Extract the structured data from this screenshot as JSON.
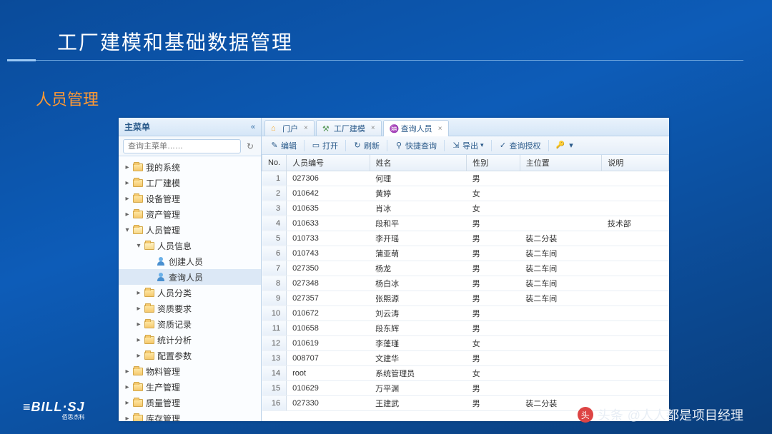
{
  "slide": {
    "title": "工厂建模和基础数据管理",
    "subtitle": "人员管理"
  },
  "sidebar": {
    "header": "主菜单",
    "search_placeholder": "查询主菜单……",
    "nodes": [
      {
        "label": "我的系统",
        "depth": 0,
        "expand": "▸",
        "icon": "folder"
      },
      {
        "label": "工厂建模",
        "depth": 0,
        "expand": "▸",
        "icon": "folder"
      },
      {
        "label": "设备管理",
        "depth": 0,
        "expand": "▸",
        "icon": "folder"
      },
      {
        "label": "资产管理",
        "depth": 0,
        "expand": "▸",
        "icon": "folder"
      },
      {
        "label": "人员管理",
        "depth": 0,
        "expand": "▾",
        "icon": "folder-open"
      },
      {
        "label": "人员信息",
        "depth": 1,
        "expand": "▾",
        "icon": "folder-open"
      },
      {
        "label": "创建人员",
        "depth": 2,
        "expand": "",
        "icon": "person"
      },
      {
        "label": "查询人员",
        "depth": 2,
        "expand": "",
        "icon": "person",
        "selected": true
      },
      {
        "label": "人员分类",
        "depth": 1,
        "expand": "▸",
        "icon": "folder"
      },
      {
        "label": "资质要求",
        "depth": 1,
        "expand": "▸",
        "icon": "folder"
      },
      {
        "label": "资质记录",
        "depth": 1,
        "expand": "▸",
        "icon": "folder"
      },
      {
        "label": "统计分析",
        "depth": 1,
        "expand": "▸",
        "icon": "folder"
      },
      {
        "label": "配置参数",
        "depth": 1,
        "expand": "▸",
        "icon": "folder"
      },
      {
        "label": "物料管理",
        "depth": 0,
        "expand": "▸",
        "icon": "folder"
      },
      {
        "label": "生产管理",
        "depth": 0,
        "expand": "▸",
        "icon": "folder"
      },
      {
        "label": "质量管理",
        "depth": 0,
        "expand": "▸",
        "icon": "folder"
      },
      {
        "label": "库存管理",
        "depth": 0,
        "expand": "▸",
        "icon": "folder"
      }
    ]
  },
  "tabs": [
    {
      "label": "门户",
      "icon": "home"
    },
    {
      "label": "工厂建模",
      "icon": "factory"
    },
    {
      "label": "查询人员",
      "icon": "chat",
      "active": true
    }
  ],
  "toolbar": [
    {
      "label": "编辑",
      "icon": "✎"
    },
    {
      "label": "打开",
      "icon": "▭"
    },
    {
      "label": "刷新",
      "icon": "↻"
    },
    {
      "label": "快捷查询",
      "icon": "⚲"
    },
    {
      "label": "导出",
      "icon": "⇲",
      "dropdown": true
    },
    {
      "label": "查询授权",
      "icon": "✓"
    },
    {
      "label": "",
      "icon": "▾",
      "key": true
    }
  ],
  "grid": {
    "columns": [
      "No.",
      "人员编号",
      "姓名",
      "性别",
      "主位置",
      "说明"
    ],
    "rows": [
      [
        "1",
        "027306",
        "何理",
        "男",
        "",
        ""
      ],
      [
        "2",
        "010642",
        "黄婷",
        "女",
        "",
        ""
      ],
      [
        "3",
        "010635",
        "肖冰",
        "女",
        "",
        ""
      ],
      [
        "4",
        "010633",
        "段和平",
        "男",
        "",
        "技术部"
      ],
      [
        "5",
        "010733",
        "李开瑶",
        "男",
        "装二分装",
        ""
      ],
      [
        "6",
        "010743",
        "蒲亚萌",
        "男",
        "装二车间",
        ""
      ],
      [
        "7",
        "027350",
        "杨龙",
        "男",
        "装二车间",
        ""
      ],
      [
        "8",
        "027348",
        "杨白冰",
        "男",
        "装二车间",
        ""
      ],
      [
        "9",
        "027357",
        "张熙源",
        "男",
        "装二车间",
        ""
      ],
      [
        "10",
        "010672",
        "刘云涛",
        "男",
        "",
        ""
      ],
      [
        "11",
        "010658",
        "段东辉",
        "男",
        "",
        ""
      ],
      [
        "12",
        "010619",
        "李蓬瑾",
        "女",
        "",
        ""
      ],
      [
        "13",
        "008707",
        "文建华",
        "男",
        "",
        ""
      ],
      [
        "14",
        "root",
        "系统管理员",
        "女",
        "",
        ""
      ],
      [
        "15",
        "010629",
        "万平渊",
        "男",
        "",
        ""
      ],
      [
        "16",
        "027330",
        "王建武",
        "男",
        "装二分装",
        ""
      ]
    ]
  },
  "footer": {
    "logo": "≡BILL·SJ",
    "logo_sub": "佰思杰科",
    "watermark_prefix": "头条",
    "watermark": "@人人都是项目经理"
  }
}
